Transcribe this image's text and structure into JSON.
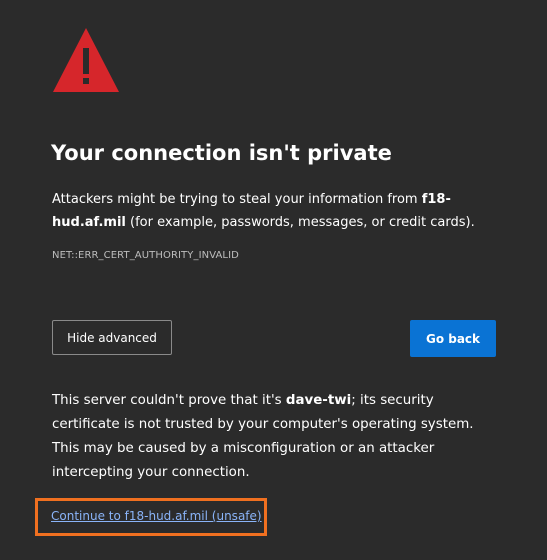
{
  "icon": {
    "name": "warning-icon",
    "color": "#d6262b",
    "mark_color": "#2b2b2b"
  },
  "title": "Your connection isn't private",
  "description": {
    "before_host": "Attackers might be trying to steal your information from ",
    "host": "f18-hud.af.mil",
    "after_host": " (for example, passwords, messages, or credit cards)."
  },
  "error_code": "NET::ERR_CERT_AUTHORITY_INVALID",
  "buttons": {
    "hide_advanced": "Hide advanced",
    "go_back": "Go back",
    "go_back_color": "#0a73d4"
  },
  "details": {
    "before_name": "This server couldn't prove that it's ",
    "name": "dave-twi",
    "after_name": "; its security certificate is not trusted by your computer's operating system. This may be caused by a misconfiguration or an attacker intercepting your connection."
  },
  "proceed_link": "Continue to f18-hud.af.mil (unsafe)",
  "colors": {
    "background": "#2b2b2b",
    "highlight": "#f07020",
    "link": "#8ab4f8"
  }
}
